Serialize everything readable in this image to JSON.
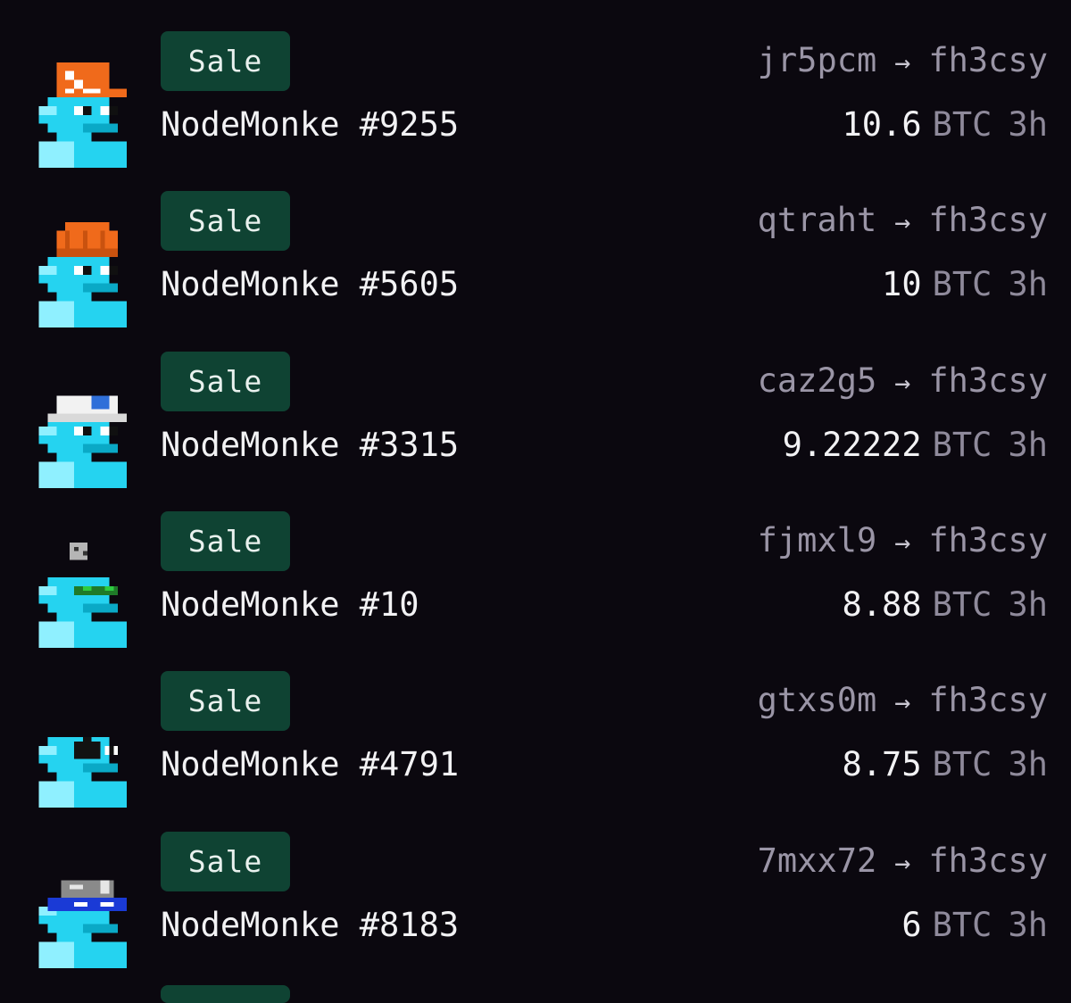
{
  "sales": [
    {
      "badge": "Sale",
      "name": "NodeMonke #9255",
      "from": "jr5pcm",
      "arrow": "→",
      "to": "fh3csy",
      "price": "10.6",
      "currency": "BTC",
      "age": "3h",
      "accessory": "orange-terminal-cap-icon"
    },
    {
      "badge": "Sale",
      "name": "NodeMonke #5605",
      "from": "qtraht",
      "arrow": "→",
      "to": "fh3csy",
      "price": "10",
      "currency": "BTC",
      "age": "3h",
      "accessory": "orange-beanie-icon"
    },
    {
      "badge": "Sale",
      "name": "NodeMonke #3315",
      "from": "caz2g5",
      "arrow": "→",
      "to": "fh3csy",
      "price": "9.22222",
      "currency": "BTC",
      "age": "3h",
      "accessory": "white-cap-icon"
    },
    {
      "badge": "Sale",
      "name": "NodeMonke #10",
      "from": "fjmxl9",
      "arrow": "→",
      "to": "fh3csy",
      "price": "8.88",
      "currency": "BTC",
      "age": "3h",
      "accessory": "green-shades-icon"
    },
    {
      "badge": "Sale",
      "name": "NodeMonke #4791",
      "from": "gtxs0m",
      "arrow": "→",
      "to": "fh3csy",
      "price": "8.75",
      "currency": "BTC",
      "age": "3h",
      "accessory": "eyepatch-icon"
    },
    {
      "badge": "Sale",
      "name": "NodeMonke #8183",
      "from": "7mxx72",
      "arrow": "→",
      "to": "fh3csy",
      "price": "6",
      "currency": "BTC",
      "age": "3h",
      "accessory": "blue-visor-icon"
    }
  ],
  "colors": {
    "background": "#0b080f",
    "badge_bg": "#0f4333",
    "monke_body": "#25d3f0",
    "monke_light": "#8ff0ff",
    "monke_dark": "#0aa9c6"
  }
}
